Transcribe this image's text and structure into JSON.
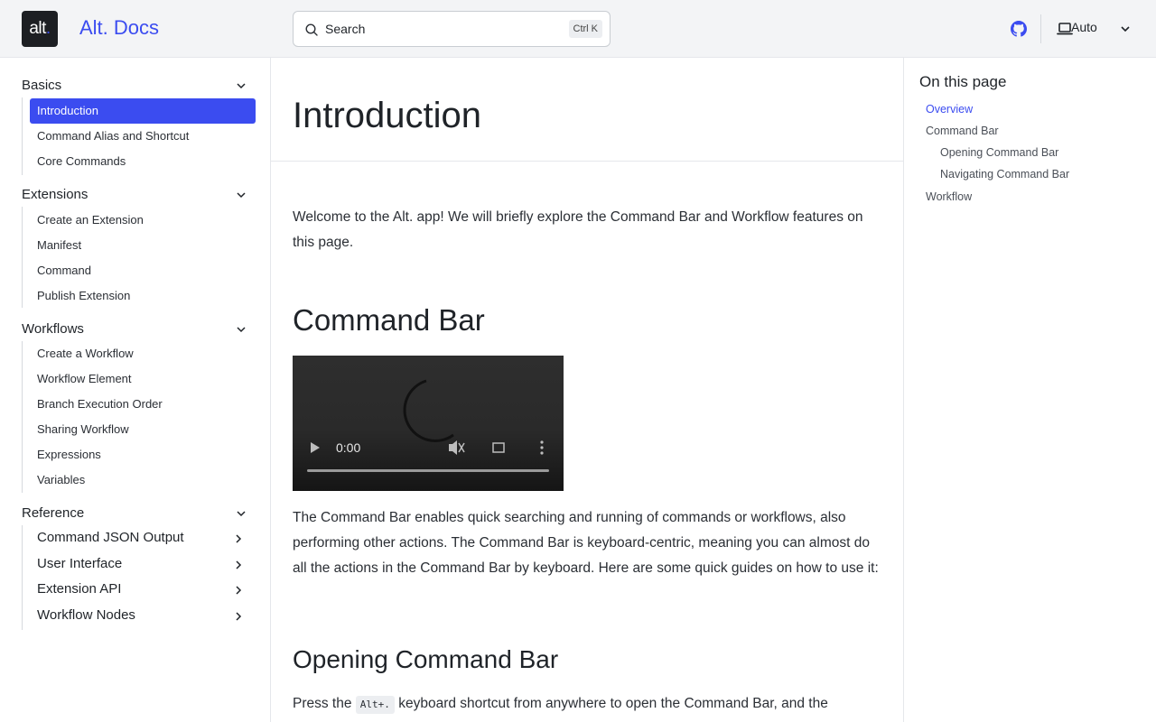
{
  "header": {
    "logo_text": "alt",
    "logo_dot": ".",
    "site_title": "Alt. Docs",
    "search_placeholder": "Search",
    "search_shortcut": "Ctrl K",
    "theme_label": "Auto",
    "accent_color": "#3b4cf0"
  },
  "sidebar": {
    "sections": [
      {
        "title": "Basics",
        "items": [
          "Introduction",
          "Command Alias and Shortcut",
          "Core Commands"
        ]
      },
      {
        "title": "Extensions",
        "items": [
          "Create an Extension",
          "Manifest",
          "Command",
          "Publish Extension"
        ]
      },
      {
        "title": "Workflows",
        "items": [
          "Create a Workflow",
          "Workflow Element",
          "Branch Execution Order",
          "Sharing Workflow",
          "Expressions",
          "Variables"
        ]
      },
      {
        "title": "Reference",
        "groups": [
          "Command JSON Output",
          "User Interface",
          "Extension API",
          "Workflow Nodes"
        ]
      }
    ],
    "active_item": "Introduction"
  },
  "main": {
    "title": "Introduction",
    "intro": "Welcome to the Alt. app! We will briefly explore the Command Bar and Workflow features on this page.",
    "command_bar_heading": "Command Bar",
    "video_time": "0:00",
    "command_bar_text": "The Command Bar enables quick searching and running of commands or workflows, also performing other actions. The Command Bar is keyboard-centric, meaning you can almost do all the actions in the Command Bar by keyboard. Here are some quick guides on how to use it:",
    "opening_heading": "Opening Command Bar",
    "opening_text_before": "Press the",
    "opening_shortcut": "Alt+.",
    "opening_text_after": "keyboard shortcut from anywhere to open the Command Bar, and the"
  },
  "toc": {
    "title": "On this page",
    "items": [
      "Overview",
      "Command Bar",
      "Opening Command Bar",
      "Navigating Command Bar",
      "Workflow"
    ]
  }
}
